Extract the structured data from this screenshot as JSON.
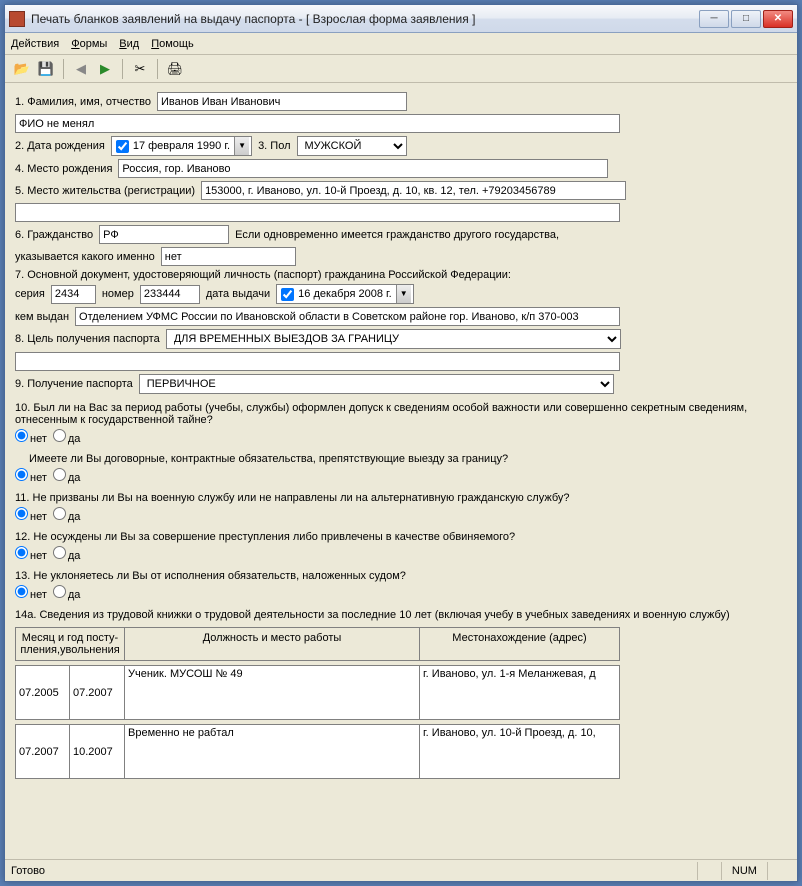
{
  "window": {
    "title": "Печать бланков заявлений на выдачу паспорта - [ Взрослая форма заявления ]"
  },
  "menu": {
    "actions": "Действия",
    "forms": "Формы",
    "view": "Вид",
    "help": "Помощь"
  },
  "labels": {
    "l1": "1. Фамилия, имя, отчество",
    "fio_change": "ФИО не менял",
    "l2": "2. Дата рождения",
    "l3": "3. Пол",
    "l4": "4. Место рождения",
    "l5": "5. Место жительства (регистрации)",
    "l6": "6. Гражданство",
    "l6b": "Если одновременно имеется гражданство другого государства,",
    "l6c": "указывается какого именно",
    "l7": "7. Основной документ, удостоверяющий личность (паспорт) гражданина Российской Федерации:",
    "l7_series": "серия",
    "l7_num": "номер",
    "l7_date": "дата выдачи",
    "l7_by": "кем выдан",
    "l8": "8. Цель получения паспорта",
    "l9": "9. Получение паспорта",
    "q10": "10. Был ли на Вас за период работы (учебы, службы) оформлен допуск к сведениям особой важности или совершенно секретным сведениям, отнесенным к государственной тайне?",
    "q10b": "Имеете ли Вы договорные, контрактные обязательства, препятствующие выезду за границу?",
    "q11": "11. Не призваны ли Вы на военную службу или не направлены ли на альтернативную гражданскую службу?",
    "q12": "12. Не осуждены ли Вы за совершение преступления либо привлечены в качестве обвиняемого?",
    "q13": "13.  Не уклоняетесь ли Вы от исполнения обязательств, наложенных судом?",
    "l14a": "14а. Сведения из трудовой книжки о трудовой деятельности за последние 10 лет (включая учебу в учебных заведениях и военную службу)",
    "th1": "Месяц и год посту-\nпления,увольнения",
    "th2": "Должность и место работы",
    "th3": "Местонахождение (адрес)",
    "no": "нет",
    "yes": "да"
  },
  "values": {
    "fio": "Иванов Иван Иванович",
    "dob": "17 февраля  1990 г.",
    "sex": "МУЖСКОЙ",
    "birthplace": "Россия, гор. Иваново",
    "address": "153000, г. Иваново, ул. 10-й Проезд, д. 10, кв. 12, тел. +79203456789",
    "citizenship": "РФ",
    "other_citizenship": "нет",
    "series": "2434",
    "number": "233444",
    "issue_date": "16 декабря  2008 г.",
    "issued_by": "Отделением УФМС России по Ивановской области в Советском районе гор. Иваново, к/п 370-003",
    "purpose": "ДЛЯ ВРЕМЕННЫХ ВЫЕЗДОВ ЗА ГРАНИЦУ",
    "obtain": "ПЕРВИЧНОЕ"
  },
  "work": [
    {
      "from": "07.2005",
      "to": "07.2007",
      "job": "Ученик. МУСОШ № 49",
      "addr": "г. Иваново, ул. 1-я Меланжевая, д"
    },
    {
      "from": "07.2007",
      "to": "10.2007",
      "job": "Временно не рабтал",
      "addr": "г. Иваново, ул. 10-й Проезд, д. 10,"
    }
  ],
  "status": {
    "ready": "Готово",
    "num": "NUM"
  }
}
